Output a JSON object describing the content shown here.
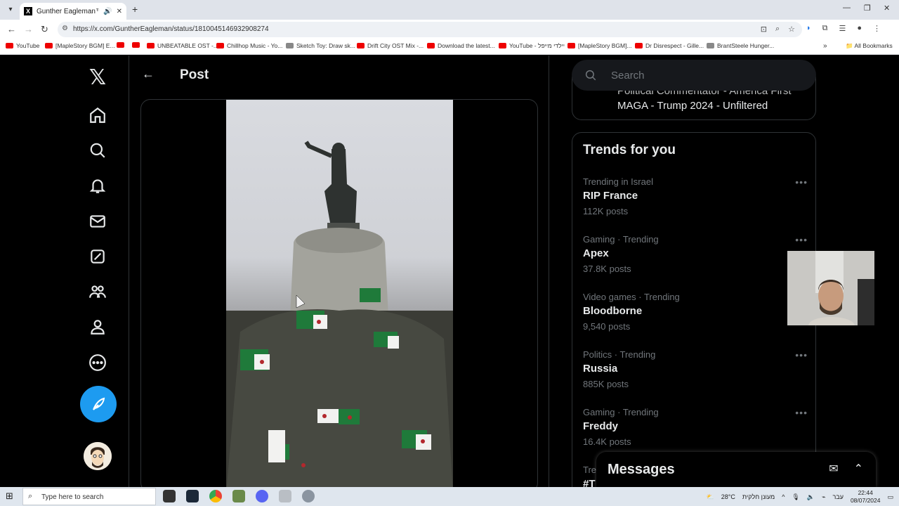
{
  "browser": {
    "tab_title": "Gunther Eagleman™ on X:",
    "url": "https://x.com/GuntherEagleman/status/1810045146932908274",
    "bookmarks": [
      "YouTube",
      "[MapleStory BGM] E...",
      "UNBEATABLE OST -...",
      "Chillhop Music - Yo...",
      "Sketch Toy: Draw sk...",
      "Drift City OST Mix -...",
      "Download the latest...",
      "YouTube - יילדי מייפל",
      "[MapleStory BGM]...",
      "Dr Disrespect - Gille...",
      "BrantSteele Hunger..."
    ],
    "all_bookmarks": "All Bookmarks"
  },
  "header": {
    "title": "Post"
  },
  "search": {
    "placeholder": "Search"
  },
  "bio": {
    "line1": "Political Commentator - America First",
    "line2": "MAGA - Trump 2024 - Unfiltered"
  },
  "trends": {
    "title": "Trends for you",
    "items": [
      {
        "context": "Trending in Israel",
        "name": "RIP France",
        "count": "112K posts"
      },
      {
        "context": "Gaming · Trending",
        "name": "Apex",
        "count": "37.8K posts"
      },
      {
        "context": "Video games · Trending",
        "name": "Bloodborne",
        "count": "9,540 posts"
      },
      {
        "context": "Politics · Trending",
        "name": "Russia",
        "count": "885K posts"
      },
      {
        "context": "Gaming · Trending",
        "name": "Freddy",
        "count": "16.4K posts"
      }
    ],
    "partial_context": "Tren",
    "partial_name": "#T"
  },
  "messages": {
    "title": "Messages"
  },
  "taskbar": {
    "search_text": "Type here to search",
    "weather": "28°C",
    "weather_text": "מעונן חלקית",
    "lang": "עבר",
    "time": "22:44",
    "date": "08/07/2024"
  },
  "icons": {
    "nav": [
      "home-icon",
      "explore-icon",
      "notifications-icon",
      "messages-icon",
      "grok-icon",
      "communities-icon",
      "profile-icon",
      "more-icon"
    ],
    "post_button": "feather-icon"
  }
}
